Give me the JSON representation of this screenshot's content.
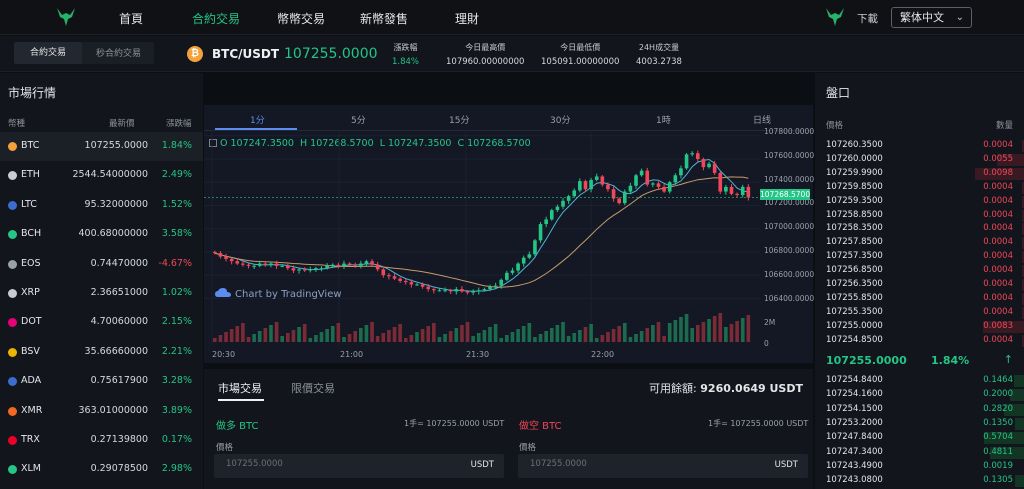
{
  "colors": {
    "up": "#24c587",
    "down": "#f0475a",
    "accent": "#5d8cf0",
    "bg": "#0b0e13"
  },
  "nav": {
    "items": [
      "首頁",
      "合約交易",
      "幣幣交易",
      "新幣發售",
      "理財"
    ],
    "active": 1,
    "download": "下載",
    "language": "繁体中文",
    "logo_icon": "bull-logo-icon"
  },
  "ticker": {
    "mode_tabs": [
      "合約交易",
      "秒合約交易"
    ],
    "coin_icon": "bitcoin-icon",
    "pair": "BTC/USDT",
    "price": "107255.0000",
    "stats": [
      {
        "label": "漲跌幅",
        "value": "1.84%"
      },
      {
        "label": "今日最高價",
        "value": "107960.00000000"
      },
      {
        "label": "今日最低價",
        "value": "105091.00000000"
      },
      {
        "label": "24H成交量",
        "value": "4003.2738"
      }
    ]
  },
  "market": {
    "title": "市場行情",
    "columns": [
      "幣種",
      "最新價",
      "漲跌幅"
    ],
    "rows": [
      {
        "name": "BTC",
        "price": "107255.0000",
        "change": "1.84%",
        "up": true,
        "color": "#f3a13a"
      },
      {
        "name": "ETH",
        "price": "2544.54000000",
        "change": "2.49%",
        "up": true,
        "color": "#c9ccd2"
      },
      {
        "name": "LTC",
        "price": "95.32000000",
        "change": "1.52%",
        "up": true,
        "color": "#3d6bd1"
      },
      {
        "name": "BCH",
        "price": "400.68000000",
        "change": "3.58%",
        "up": true,
        "color": "#24c587"
      },
      {
        "name": "EOS",
        "price": "0.74470000",
        "change": "-4.67%",
        "up": false,
        "color": "#9aa0a8"
      },
      {
        "name": "XRP",
        "price": "2.36651000",
        "change": "1.02%",
        "up": true,
        "color": "#c9ccd2"
      },
      {
        "name": "DOT",
        "price": "4.70060000",
        "change": "2.15%",
        "up": true,
        "color": "#e6007a"
      },
      {
        "name": "BSV",
        "price": "35.66660000",
        "change": "2.21%",
        "up": true,
        "color": "#eab300"
      },
      {
        "name": "ADA",
        "price": "0.75617900",
        "change": "3.28%",
        "up": true,
        "color": "#3d6bd1"
      },
      {
        "name": "XMR",
        "price": "363.01000000",
        "change": "3.89%",
        "up": true,
        "color": "#f26822"
      },
      {
        "name": "TRX",
        "price": "0.27139800",
        "change": "0.17%",
        "up": true,
        "color": "#ef0027"
      },
      {
        "name": "XLM",
        "price": "0.29078500",
        "change": "2.98%",
        "up": true,
        "color": "#24c587"
      }
    ]
  },
  "chart": {
    "timeframes": [
      "1分",
      "5分",
      "15分",
      "30分",
      "1時",
      "日线"
    ],
    "active_tf": 0,
    "ohlc": [
      "O 107247.3500",
      "H 107268.5700",
      "L 107247.3500",
      "C 107268.5700"
    ],
    "watermark": "Chart by TradingView",
    "price_tag": "107268.5700",
    "y_labels": [
      "107800.0000",
      "107600.0000",
      "107400.0000",
      "107200.0000",
      "107000.0000",
      "106800.0000",
      "106600.0000",
      "106400.0000"
    ],
    "vol_labels": [
      "2M",
      "0"
    ],
    "x_labels": [
      "20:30",
      "21:00",
      "21:30",
      "22:00"
    ]
  },
  "chart_data": {
    "type": "candlestick",
    "ylim": [
      106300,
      107850
    ],
    "y_ticks": [
      107800,
      107600,
      107400,
      107200,
      107000,
      106800,
      106600,
      106400
    ],
    "close": [
      106790,
      106760,
      106740,
      106720,
      106700,
      106690,
      106680,
      106680,
      106700,
      106690,
      106700,
      106680,
      106680,
      106660,
      106640,
      106650,
      106640,
      106650,
      106660,
      106660,
      106680,
      106690,
      106680,
      106700,
      106690,
      106680,
      106700,
      106720,
      106690,
      106650,
      106600,
      106590,
      106570,
      106550,
      106540,
      106520,
      106520,
      106500,
      106480,
      106470,
      106470,
      106470,
      106460,
      106480,
      106460,
      106450,
      106460,
      106470,
      106480,
      106500,
      106510,
      106560,
      106620,
      106640,
      106700,
      106750,
      106780,
      106900,
      107040,
      107080,
      107160,
      107190,
      107240,
      107280,
      107330,
      107410,
      107340,
      107420,
      107450,
      107380,
      107340,
      107260,
      107220,
      107320,
      107370,
      107460,
      107500,
      107380,
      107390,
      107360,
      107320,
      107400,
      107460,
      107520,
      107640,
      107650,
      107600,
      107530,
      107560,
      107480,
      107320,
      107360,
      107300,
      107290,
      107360,
      107270
    ]
  },
  "trade": {
    "tabs": [
      "市場交易",
      "限價交易"
    ],
    "available": "可用餘額:",
    "balance": "9260.0649 USDT",
    "buy": {
      "label": "做多 BTC",
      "lot": "1手= 107255.0000 USDT",
      "price_label": "價格",
      "placeholder": "107255.0000",
      "unit": "USDT"
    },
    "sell": {
      "label": "做空 BTC",
      "lot": "1手= 107255.0000 USDT",
      "price_label": "價格",
      "placeholder": "107255.0000",
      "unit": "USDT"
    }
  },
  "orderbook": {
    "title": "盤口",
    "columns": [
      "價格",
      "數量"
    ],
    "asks": [
      [
        "107260.3500",
        "0.0004"
      ],
      [
        "107260.0000",
        "0.0055"
      ],
      [
        "107259.9900",
        "0.0098"
      ],
      [
        "107259.8500",
        "0.0004"
      ],
      [
        "107259.3500",
        "0.0004"
      ],
      [
        "107258.8500",
        "0.0004"
      ],
      [
        "107258.3500",
        "0.0004"
      ],
      [
        "107257.8500",
        "0.0004"
      ],
      [
        "107257.3500",
        "0.0004"
      ],
      [
        "107256.8500",
        "0.0004"
      ],
      [
        "107256.3500",
        "0.0004"
      ],
      [
        "107255.8500",
        "0.0004"
      ],
      [
        "107255.3500",
        "0.0004"
      ],
      [
        "107255.0000",
        "0.0083"
      ],
      [
        "107254.8500",
        "0.0004"
      ]
    ],
    "mid_price": "107255.0000",
    "mid_change": "1.84%",
    "mid_arrow": "↑",
    "bids": [
      [
        "107254.8400",
        "0.1464"
      ],
      [
        "107254.1600",
        "0.2000"
      ],
      [
        "107254.1500",
        "0.2820"
      ],
      [
        "107253.2000",
        "0.1350"
      ],
      [
        "107247.8400",
        "0.5704"
      ],
      [
        "107247.3400",
        "0.4811"
      ],
      [
        "107243.4900",
        "0.0019"
      ],
      [
        "107243.0800",
        "0.1305"
      ]
    ]
  }
}
